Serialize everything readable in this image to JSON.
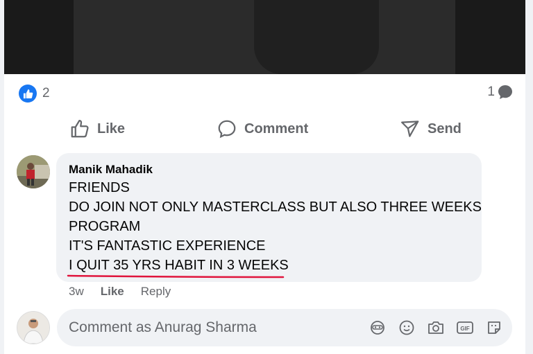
{
  "post": {
    "reaction_count": "2",
    "comment_count": "1"
  },
  "actions": {
    "like": "Like",
    "comment": "Comment",
    "send": "Send"
  },
  "comment": {
    "author": "Manik Mahadik",
    "lines": [
      "FRIENDS",
      "DO JOIN NOT ONLY MASTERCLASS BUT ALSO THREE WEEKS",
      "PROGRAM",
      "IT'S FANTASTIC EXPERIENCE",
      "I QUIT 35 YRS HABIT IN 3 WEEKS"
    ],
    "time": "3w",
    "like_label": "Like",
    "reply_label": "Reply"
  },
  "composer": {
    "placeholder": "Comment as Anurag Sharma",
    "tools": [
      "avatar-sticker-icon",
      "emoji-icon",
      "camera-icon",
      "gif-icon",
      "sticker-icon"
    ]
  },
  "colors": {
    "accent": "#1877f2",
    "underline": "#e0143c",
    "bubble": "#f0f2f5",
    "muted_text": "#65676b"
  }
}
